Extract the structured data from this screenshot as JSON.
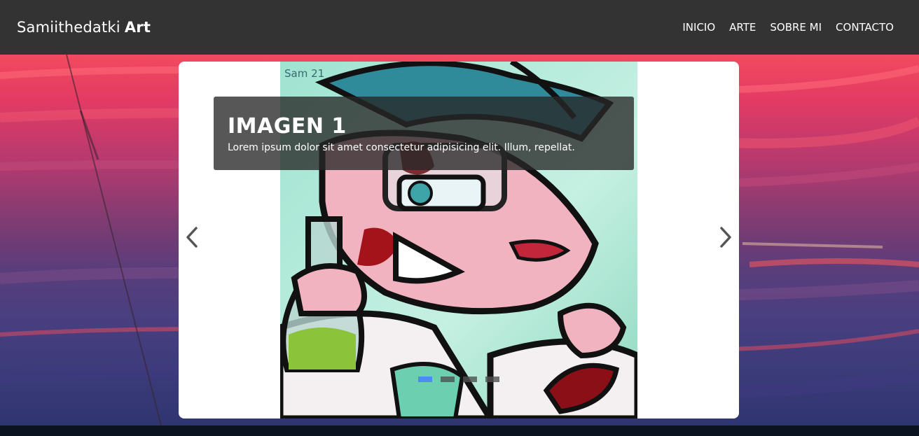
{
  "brand": {
    "name": "Samiithedatki",
    "highlight": "Art"
  },
  "nav": {
    "items": [
      "INICIO",
      "ARTE",
      "SOBRE MI",
      "CONTACTO"
    ]
  },
  "carousel": {
    "caption": {
      "title": "IMAGEN 1",
      "text": "Lorem ipsum dolor sit amet consectetur adipisicing elit. Illum, repellat."
    },
    "artwork_signature": "Sam 21",
    "slides_count": 4,
    "active_index": 0,
    "prev_icon": "chevron-left-icon",
    "next_icon": "chevron-right-icon"
  },
  "colors": {
    "header": "#333333",
    "indicator_active": "#4a8cf0",
    "caption_bg": "#282828"
  }
}
